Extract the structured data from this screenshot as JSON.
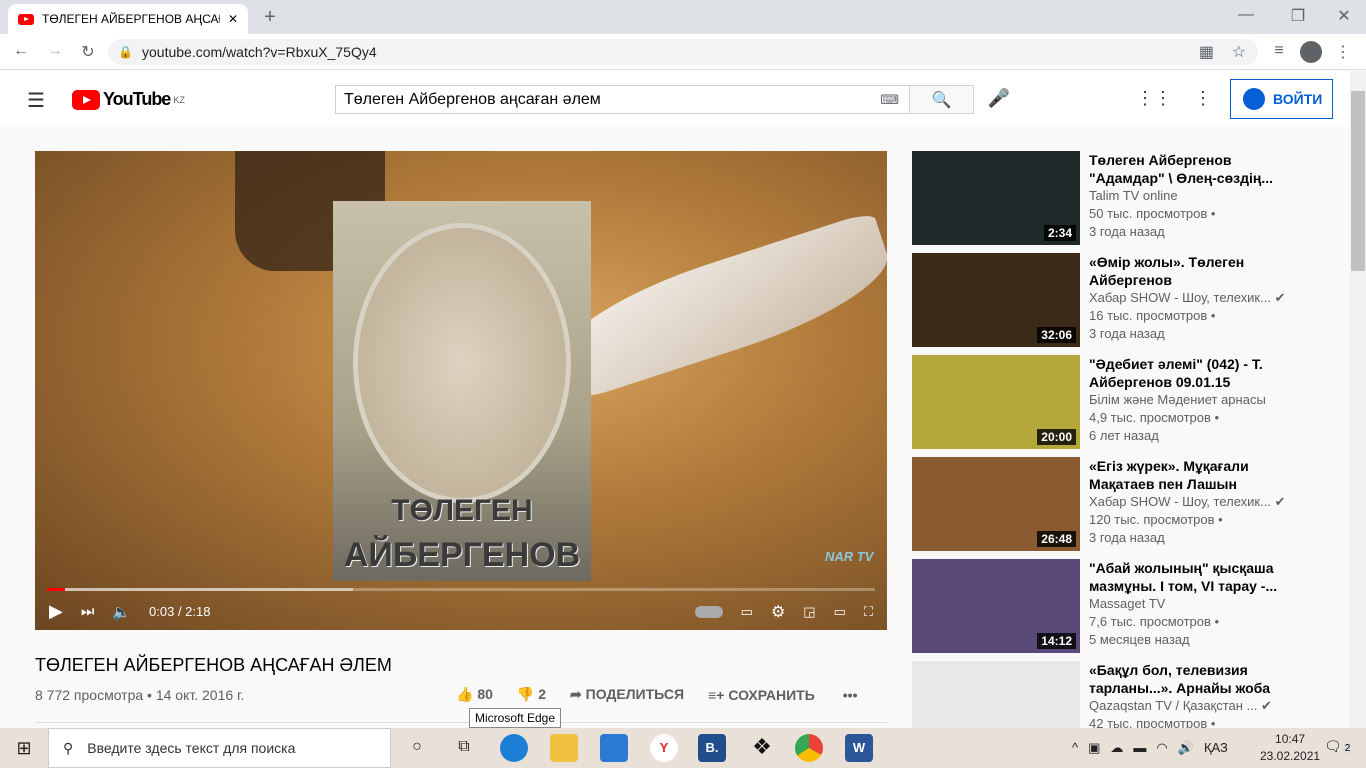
{
  "browser": {
    "tab_title": "ТӨЛЕГЕН АЙБЕРГЕНОВ АҢСАҒА",
    "url": "youtube.com/watch?v=RbxuX_75Qy4"
  },
  "header": {
    "logo": "YouTube",
    "region": "KZ",
    "search_value": "Төлеген Айбергенов аңсаған әлем",
    "signin": "ВОЙТИ"
  },
  "player": {
    "time": "0:03 / 2:18",
    "progress": 0.022,
    "buffered": 0.37,
    "overlay_text": [
      "ТӨЛЕГЕН",
      "АЙБЕРГЕНОВ"
    ],
    "watermark": "NAR TV"
  },
  "video": {
    "title": "ТӨЛЕГЕН АЙБЕРГЕНОВ АҢСАҒАН ӘЛЕМ",
    "meta": "8 772 просмотра • 14 окт. 2016 г.",
    "likes": "80",
    "dislikes": "2",
    "share": "ПОДЕЛИТЬСЯ",
    "save": "СОХРАНИТЬ"
  },
  "tooltip": "Microsoft Edge",
  "related": [
    {
      "title": "Төлеген Айбергенов \"Адамдар\" \\ Өлең-сөздің...",
      "channel": "Talim TV online",
      "views": "50 тыс. просмотров •",
      "age": "3 года назад",
      "duration": "2:34",
      "verified": false,
      "color": "#1f2a2a"
    },
    {
      "title": "«Өмір жолы». Төлеген Айбергенов",
      "channel": "Хабар SHOW - Шоу, телехик...",
      "views": "16 тыс. просмотров •",
      "age": "3 года назад",
      "duration": "32:06",
      "verified": true,
      "color": "#3b2a18"
    },
    {
      "title": "\"Әдебиет әлемі\" (042) - Т. Айбергенов 09.01.15",
      "channel": "Білім және Мәдениет арнасы",
      "views": "4,9 тыс. просмотров •",
      "age": "6 лет назад",
      "duration": "20:00",
      "verified": false,
      "color": "#b5a83a"
    },
    {
      "title": "«Егіз жүрек». Мұқағали Мақатаев пен Лашын",
      "channel": "Хабар SHOW - Шоу, телехик...",
      "views": "120 тыс. просмотров •",
      "age": "3 года назад",
      "duration": "26:48",
      "verified": true,
      "color": "#8a5a30"
    },
    {
      "title": "\"Абай жолының\" қысқаша мазмұны. I том, VI тарау -...",
      "channel": "Massaget TV",
      "views": "7,6 тыс. просмотров •",
      "age": "5 месяцев назад",
      "duration": "14:12",
      "verified": false,
      "color": "#5a4a7a"
    },
    {
      "title": "«Бақұл бол, телевизия тарланы...». Арнайы жоба",
      "channel": "Qazaqstan TV / Қазақстан ...",
      "views": "42 тыс. просмотров •",
      "age": "",
      "duration": "",
      "verified": true,
      "color": "#e8e8e8"
    }
  ],
  "taskbar": {
    "search_placeholder": "Введите здесь текст для поиска",
    "lang": "ҚАЗ",
    "time": "10:47",
    "date": "23.02.2021",
    "notifications": "2"
  }
}
